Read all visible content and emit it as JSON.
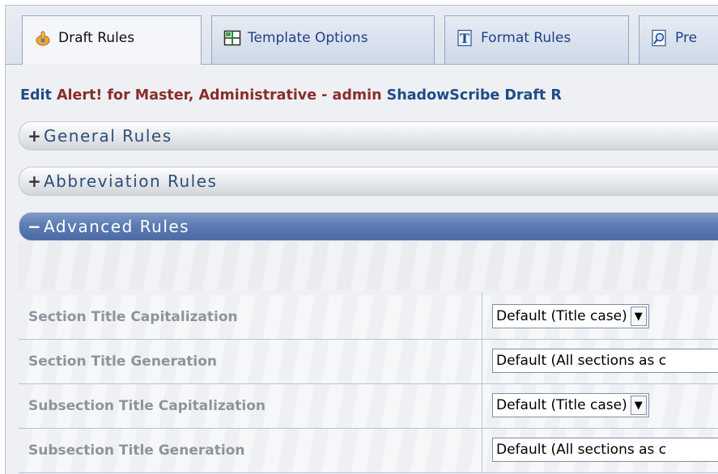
{
  "tabs": [
    {
      "label": "Draft Rules",
      "icon": "hand-pointer-icon",
      "active": true
    },
    {
      "label": "Template Options",
      "icon": "grid-table-icon",
      "active": false
    },
    {
      "label": "Format Rules",
      "icon": "text-format-icon",
      "active": false
    },
    {
      "label": "Pre",
      "icon": "preview-magnifier-icon",
      "active": false
    }
  ],
  "heading": {
    "prefix": "Edit ",
    "alert": "Alert! for Master, Administrative - admin",
    "suffix": " ShadowScribe Draft R"
  },
  "panels": {
    "general": {
      "sign": "+",
      "title": "General Rules"
    },
    "abbreviation": {
      "sign": "+",
      "title": "Abbreviation Rules"
    },
    "advanced": {
      "sign": "−",
      "title": "Advanced Rules"
    }
  },
  "advanced_rules": [
    {
      "label": "Section Title Capitalization",
      "value": "Default (Title case)",
      "has_arrow": true
    },
    {
      "label": "Section Title Generation",
      "value": "Default (All sections as c",
      "has_arrow": false
    },
    {
      "label": "Subsection Title Capitalization",
      "value": "Default (Title case)",
      "has_arrow": true
    },
    {
      "label": "Subsection Title Generation",
      "value": "Default (All sections as c",
      "has_arrow": false
    }
  ],
  "colors": {
    "accent_blue": "#4b6aa3",
    "heading_blue": "#1f4c86",
    "heading_red": "#8a2c2c"
  }
}
